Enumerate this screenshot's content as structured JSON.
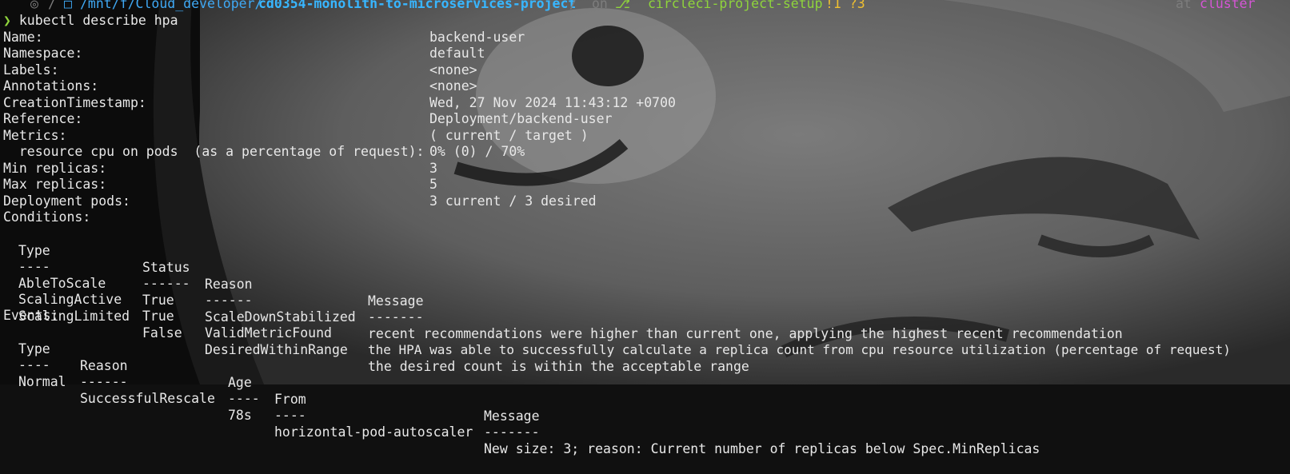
{
  "prompt": {
    "os_glyph": "◎",
    "sep": "/",
    "folder_glyph": "□",
    "path_prefix": "/mnt/f/Cloud_developer/",
    "path_dir": "cd0354-monolith-to-microservices-project",
    "on_text": "on",
    "git_glyph": "⎇",
    "branch": "circleci-project-setup",
    "status": "!1 ?3",
    "at_text": "at",
    "context": "cluster"
  },
  "command": {
    "symbol": "❯",
    "text": "kubectl describe hpa"
  },
  "hpa": {
    "fields": [
      {
        "key": "Name:",
        "value": "backend-user"
      },
      {
        "key": "Namespace:",
        "value": "default"
      },
      {
        "key": "Labels:",
        "value": "<none>"
      },
      {
        "key": "Annotations:",
        "value": "<none>"
      },
      {
        "key": "CreationTimestamp:",
        "value": "Wed, 27 Nov 2024 11:43:12 +0700"
      },
      {
        "key": "Reference:",
        "value": "Deployment/backend-user"
      },
      {
        "key": "Metrics:",
        "value": "( current / target )"
      },
      {
        "key": "  resource cpu on pods  (as a percentage of request):",
        "value": "0% (0) / 70%"
      },
      {
        "key": "Min replicas:",
        "value": "3"
      },
      {
        "key": "Max replicas:",
        "value": "5"
      },
      {
        "key": "Deployment pods:",
        "value": "3 current / 3 desired"
      }
    ],
    "conditions_label": "Conditions:",
    "conditions": {
      "headers": [
        "Type",
        "Status",
        "Reason",
        "Message"
      ],
      "dashes": [
        "----",
        "------",
        "------",
        "-------"
      ],
      "rows": [
        [
          "AbleToScale",
          "True",
          "ScaleDownStabilized",
          "recent recommendations were higher than current one, applying the highest recent recommendation"
        ],
        [
          "ScalingActive",
          "True",
          "ValidMetricFound",
          "the HPA was able to successfully calculate a replica count from cpu resource utilization (percentage of request)"
        ],
        [
          "ScalingLimited",
          "False",
          "DesiredWithinRange",
          "the desired count is within the acceptable range"
        ]
      ]
    },
    "events_label": "Events:",
    "events": {
      "headers": [
        "Type",
        "Reason",
        "Age",
        "From",
        "Message"
      ],
      "dashes": [
        "----",
        "------",
        "----",
        "----",
        "-------"
      ],
      "rows": [
        [
          "Normal",
          "SuccessfulRescale",
          "78s",
          "horizontal-pod-autoscaler",
          "New size: 3; reason: Current number of replicas below Spec.MinReplicas"
        ]
      ]
    }
  }
}
